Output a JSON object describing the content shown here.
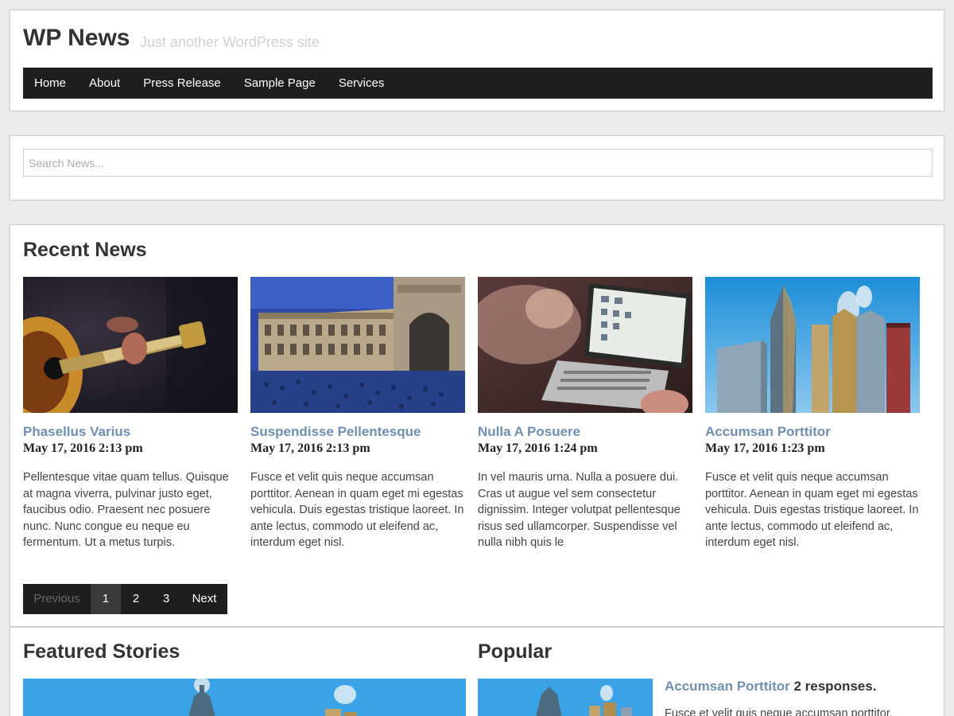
{
  "site": {
    "title": "WP News",
    "tagline": "Just another WordPress site"
  },
  "nav": {
    "items": [
      "Home",
      "About",
      "Press Release",
      "Sample Page",
      "Services"
    ]
  },
  "search": {
    "placeholder": "Search News..."
  },
  "recent": {
    "title": "Recent News",
    "cards": [
      {
        "title": "Phasellus Varius",
        "date": "May 17, 2016 2:13 pm",
        "excerpt": "Pellentesque vitae quam tellus. Quisque at magna viverra, pulvinar justo eget, faucibus odio. Praesent nec posuere nunc. Nunc congue eu neque eu fermentum. Ut a metus turpis."
      },
      {
        "title": "Suspendisse Pellentesque",
        "date": "May 17, 2016 2:13 pm",
        "excerpt": "Fusce et velit quis neque accumsan porttitor. Aenean in quam eget mi egestas vehicula. Duis egestas tristique laoreet. In ante lectus, commodo ut eleifend ac, interdum eget nisl."
      },
      {
        "title": "Nulla A Posuere",
        "date": "May 17, 2016 1:24 pm",
        "excerpt": "In vel mauris urna. Nulla a posuere dui. Cras ut augue vel sem consectetur dignissim. Integer volutpat pellentesque risus sed ullamcorper. Suspendisse vel nulla nibh quis le"
      },
      {
        "title": "Accumsan Porttitor",
        "date": "May 17, 2016 1:23 pm",
        "excerpt": "Fusce et velit quis neque accumsan porttitor. Aenean in quam eget mi egestas vehicula. Duis egestas tristique laoreet. In ante lectus, commodo ut eleifend ac, interdum eget nisl."
      }
    ]
  },
  "pagination": {
    "previous": "Previous",
    "pages": [
      "1",
      "2",
      "3"
    ],
    "current": "1",
    "next": "Next"
  },
  "featured": {
    "title": "Featured Stories"
  },
  "popular": {
    "title": "Popular",
    "item_title": "Accumsan Porttitor",
    "item_responses": "2 responses.",
    "item_excerpt": "Fusce et velit quis neque accumsan porttitor."
  },
  "colors": {
    "nav_bg": "#1e1e1e",
    "link": "#6f8fb3",
    "page_bg": "#ececec"
  }
}
